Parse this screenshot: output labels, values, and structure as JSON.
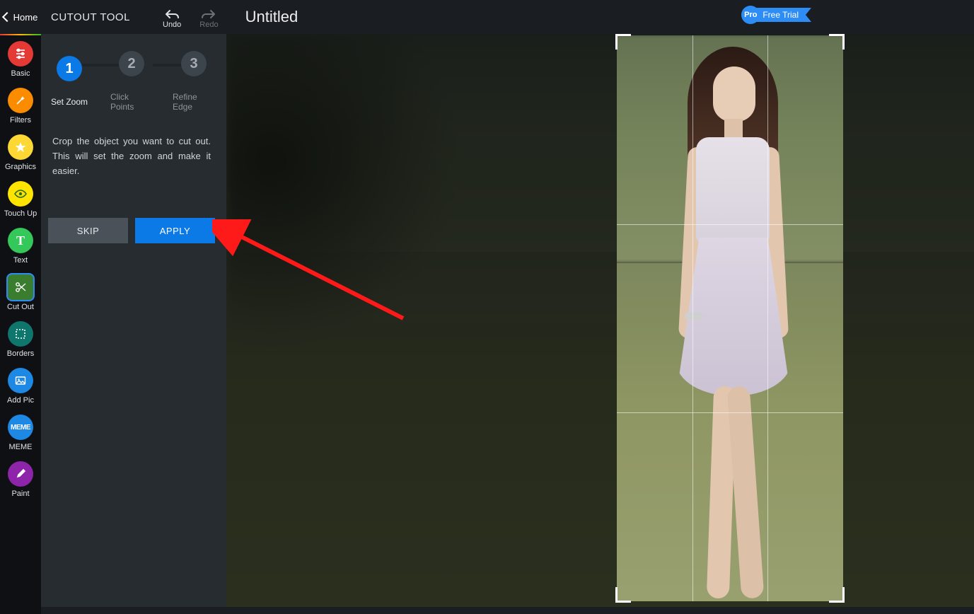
{
  "header": {
    "home_label": "Home",
    "panel_title": "CUTOUT TOOL",
    "undo_label": "Undo",
    "redo_label": "Redo",
    "doc_title": "Untitled",
    "pro_badge": "Pro",
    "pro_flag": "Free Trial"
  },
  "rail": [
    {
      "id": "basic",
      "label": "Basic",
      "color": "#e53935"
    },
    {
      "id": "filters",
      "label": "Filters",
      "color": "#fb8c00"
    },
    {
      "id": "graphics",
      "label": "Graphics",
      "color": "#fdd835"
    },
    {
      "id": "touchup",
      "label": "Touch Up",
      "color": "#ffe400"
    },
    {
      "id": "text",
      "label": "Text",
      "color": "#34c759"
    },
    {
      "id": "cutout",
      "label": "Cut Out",
      "color": "#3b7d2f"
    },
    {
      "id": "borders",
      "label": "Borders",
      "color": "#0f766e"
    },
    {
      "id": "addpic",
      "label": "Add Pic",
      "color": "#1e88e5"
    },
    {
      "id": "meme",
      "label": "MEME",
      "color": "#1e88e5"
    },
    {
      "id": "paint",
      "label": "Paint",
      "color": "#8e24aa"
    }
  ],
  "steps": [
    {
      "num": "1",
      "label": "Set Zoom"
    },
    {
      "num": "2",
      "label": "Click Points"
    },
    {
      "num": "3",
      "label": "Refine Edge"
    }
  ],
  "panel": {
    "help_text": "Crop the object you want to cut out. This will set the zoom and make it easier.",
    "skip_label": "SKIP",
    "apply_label": "APPLY"
  }
}
